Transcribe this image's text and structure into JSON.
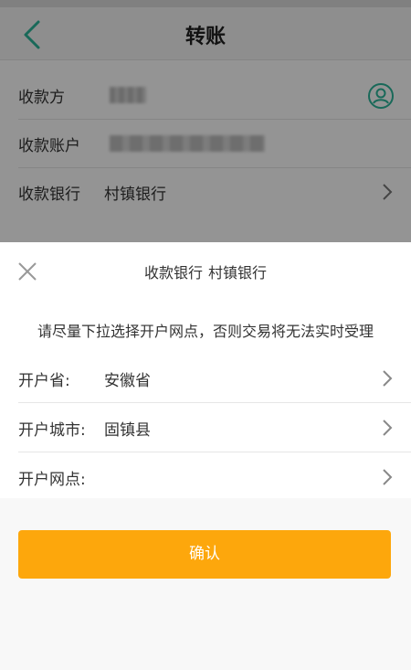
{
  "nav": {
    "title": "转账"
  },
  "transfer_form": {
    "rows": [
      {
        "label": "收款方",
        "value": ""
      },
      {
        "label": "收款账户",
        "value": ""
      },
      {
        "label": "收款银行",
        "value": "村镇银行"
      }
    ]
  },
  "sheet": {
    "title_label": "收款银行",
    "title_value": "村镇银行",
    "hint": "请尽量下拉选择开户网点，否则交易将无法实时受理",
    "rows": [
      {
        "label": "开户省:",
        "value": "安徽省"
      },
      {
        "label": "开户城市:",
        "value": "固镇县"
      },
      {
        "label": "开户网点:",
        "value": ""
      }
    ],
    "confirm_label": "确认"
  },
  "colors": {
    "accent_teal": "#2bb59a",
    "confirm_orange": "#fda70c"
  },
  "icons": [
    "back-arrow-icon",
    "contact-icon",
    "chevron-right-icon",
    "close-icon"
  ]
}
